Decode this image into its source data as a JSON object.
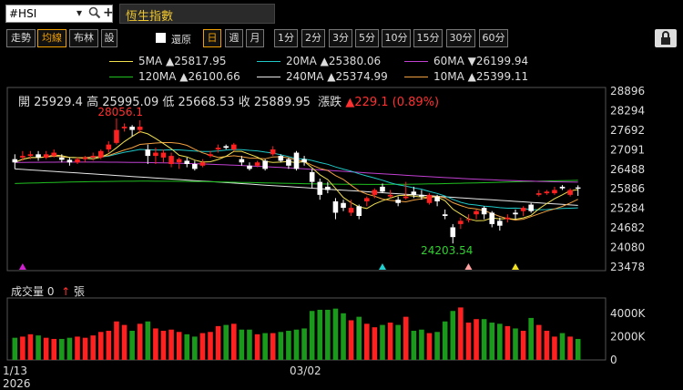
{
  "toolbar": {
    "symbol": "#HSI",
    "title": "恆生指數",
    "view_tabs": [
      "走勢",
      "均線",
      "布林",
      "設"
    ],
    "adjust_label": "還原",
    "periods": [
      "日",
      "週",
      "月"
    ],
    "minutes": [
      "1分",
      "2分",
      "3分",
      "5分",
      "10分",
      "15分",
      "30分",
      "60分"
    ],
    "active_view": "均線",
    "active_period": "日"
  },
  "ma_legend": [
    {
      "name": "5MA",
      "dir": "▲",
      "value": "25817.95",
      "color": "#f0e050"
    },
    {
      "name": "20MA",
      "dir": "▲",
      "value": "25380.06",
      "color": "#20c8c8"
    },
    {
      "name": "60MA",
      "dir": "▼",
      "value": "26199.94",
      "color": "#c040d0"
    },
    {
      "name": "120MA",
      "dir": "▲",
      "value": "26100.66",
      "color": "#20c020"
    },
    {
      "name": "240MA",
      "dir": "▲",
      "value": "25374.99",
      "color": "#e8e8e8"
    },
    {
      "name": "10MA",
      "dir": "▲",
      "value": "25399.11",
      "color": "#f0a040"
    }
  ],
  "ohlc": {
    "open_label": "開",
    "open": "25929.4",
    "high_label": "高",
    "high": "25995.09",
    "low_label": "低",
    "low": "25668.53",
    "close_label": "收",
    "close": "25889.95",
    "change_label": "漲跌",
    "change": "▲229.1 (0.89%)"
  },
  "volume_label": "成交量",
  "volume_value": "0",
  "volume_unit": "張",
  "volume_arrow": "↑",
  "x_labels": {
    "left_date": "1/13",
    "left_year": "2026",
    "mid_date": "03/02"
  },
  "chart_data": {
    "type": "candlestick",
    "y_ticks": [
      28896,
      28294,
      27692,
      27091,
      26488,
      25886,
      25284,
      24682,
      24080,
      23478
    ],
    "ylim": [
      23478,
      28896
    ],
    "volume_ticks": [
      "4000K",
      "2000K",
      "0"
    ],
    "volume_ylim": [
      0,
      5000
    ],
    "annotations": [
      {
        "text": "28056.1",
        "value": 28056.1,
        "index": 12
      },
      {
        "text": "24203.54",
        "value": 24203.54,
        "index": 54
      }
    ],
    "markers": [
      {
        "index": 1,
        "color": "#d020d0"
      },
      {
        "index": 47,
        "color": "#20d0d0"
      },
      {
        "index": 58,
        "color": "#ffa0a0"
      },
      {
        "index": 64,
        "color": "#f0e020"
      }
    ],
    "candles": [
      [
        26800,
        26700,
        26950,
        26500,
        1900
      ],
      [
        26850,
        26900,
        27050,
        26750,
        2000
      ],
      [
        26900,
        26950,
        27050,
        26800,
        2200
      ],
      [
        26950,
        26850,
        27050,
        26750,
        2100
      ],
      [
        26850,
        26950,
        27050,
        26800,
        1900
      ],
      [
        26900,
        27000,
        27100,
        26850,
        1800
      ],
      [
        26850,
        26780,
        26950,
        26700,
        1800
      ],
      [
        26780,
        26700,
        26850,
        26600,
        1900
      ],
      [
        26700,
        26800,
        26850,
        26650,
        2000
      ],
      [
        26800,
        26850,
        26900,
        26700,
        1900
      ],
      [
        26850,
        26900,
        27000,
        26750,
        2100
      ],
      [
        26850,
        27050,
        27100,
        26800,
        2400
      ],
      [
        27100,
        27250,
        27350,
        27000,
        2500
      ],
      [
        27300,
        27700,
        28056,
        27250,
        3300
      ],
      [
        27750,
        27800,
        27900,
        27650,
        3000
      ],
      [
        27800,
        27700,
        27850,
        27500,
        2500
      ],
      [
        27700,
        27800,
        28000,
        27600,
        3100
      ],
      [
        27100,
        26900,
        27250,
        26650,
        3300
      ],
      [
        26900,
        27000,
        27150,
        26650,
        2700
      ],
      [
        26850,
        27000,
        27100,
        26700,
        2500
      ],
      [
        26650,
        26900,
        27000,
        26550,
        2600
      ],
      [
        26700,
        26800,
        26850,
        26500,
        2400
      ],
      [
        26750,
        26650,
        26850,
        26550,
        2200
      ],
      [
        26650,
        26500,
        26750,
        26450,
        2000
      ],
      [
        26600,
        26700,
        26800,
        26550,
        2300
      ],
      [
        26900,
        26950,
        27050,
        26850,
        2400
      ],
      [
        27100,
        27150,
        27250,
        27000,
        2900
      ],
      [
        27200,
        27150,
        27250,
        27100,
        3000
      ],
      [
        27100,
        27250,
        27300,
        27050,
        3100
      ],
      [
        26800,
        26700,
        26900,
        26600,
        2600
      ],
      [
        26600,
        26500,
        26700,
        26450,
        2600
      ],
      [
        26600,
        26700,
        26750,
        26550,
        2200
      ],
      [
        26750,
        26500,
        26800,
        26450,
        2300
      ],
      [
        26950,
        27100,
        27200,
        26900,
        2300
      ],
      [
        26900,
        26750,
        26950,
        26700,
        2400
      ],
      [
        26800,
        26600,
        26850,
        26500,
        2500
      ],
      [
        27000,
        26500,
        27050,
        26450,
        2600
      ],
      [
        26800,
        26700,
        26900,
        26600,
        2700
      ],
      [
        26400,
        26100,
        26500,
        25900,
        4200
      ],
      [
        26100,
        25700,
        26200,
        25550,
        4300
      ],
      [
        25950,
        25850,
        26100,
        25750,
        4300
      ],
      [
        25500,
        25150,
        25600,
        24950,
        4400
      ],
      [
        25450,
        25300,
        25550,
        25200,
        4000
      ],
      [
        25150,
        25300,
        25550,
        25050,
        3400
      ],
      [
        25350,
        25050,
        25400,
        24950,
        3700
      ],
      [
        25500,
        25600,
        25650,
        25350,
        3100
      ],
      [
        25700,
        25850,
        25900,
        25600,
        2800
      ],
      [
        25950,
        25800,
        26050,
        25750,
        3000
      ],
      [
        25650,
        25700,
        25850,
        25600,
        3200
      ],
      [
        25550,
        25450,
        25650,
        25350,
        3000
      ],
      [
        25600,
        25650,
        26100,
        25550,
        3700
      ],
      [
        25800,
        25700,
        25950,
        25600,
        2500
      ],
      [
        25700,
        25650,
        25850,
        25550,
        2600
      ],
      [
        25450,
        25700,
        25750,
        25400,
        2300
      ],
      [
        25650,
        25500,
        25700,
        25350,
        2400
      ],
      [
        25100,
        25050,
        25250,
        24950,
        3300
      ],
      [
        24700,
        24400,
        24800,
        24203,
        4200
      ],
      [
        24800,
        24900,
        25000,
        24650,
        4500
      ],
      [
        24950,
        24950,
        25100,
        24850,
        3200
      ],
      [
        25100,
        25200,
        25250,
        24950,
        3500
      ],
      [
        25300,
        25100,
        25350,
        24950,
        3500
      ],
      [
        25150,
        24800,
        25200,
        24700,
        3200
      ],
      [
        24900,
        24750,
        25000,
        24600,
        3100
      ],
      [
        24950,
        25000,
        25100,
        24850,
        2900
      ],
      [
        25150,
        25100,
        25250,
        24950,
        2700
      ],
      [
        25200,
        25300,
        25350,
        25050,
        2500
      ],
      [
        25400,
        25200,
        25450,
        25150,
        3600
      ],
      [
        25700,
        25750,
        25850,
        25650,
        3000
      ],
      [
        25750,
        25800,
        25850,
        25700,
        2500
      ],
      [
        25750,
        25850,
        25950,
        25700,
        2000
      ],
      [
        25950,
        25900,
        26000,
        25850,
        2300
      ],
      [
        25700,
        25850,
        25900,
        25650,
        2000
      ],
      [
        25929.4,
        25889.95,
        25995.09,
        25668.53,
        1800
      ]
    ]
  }
}
